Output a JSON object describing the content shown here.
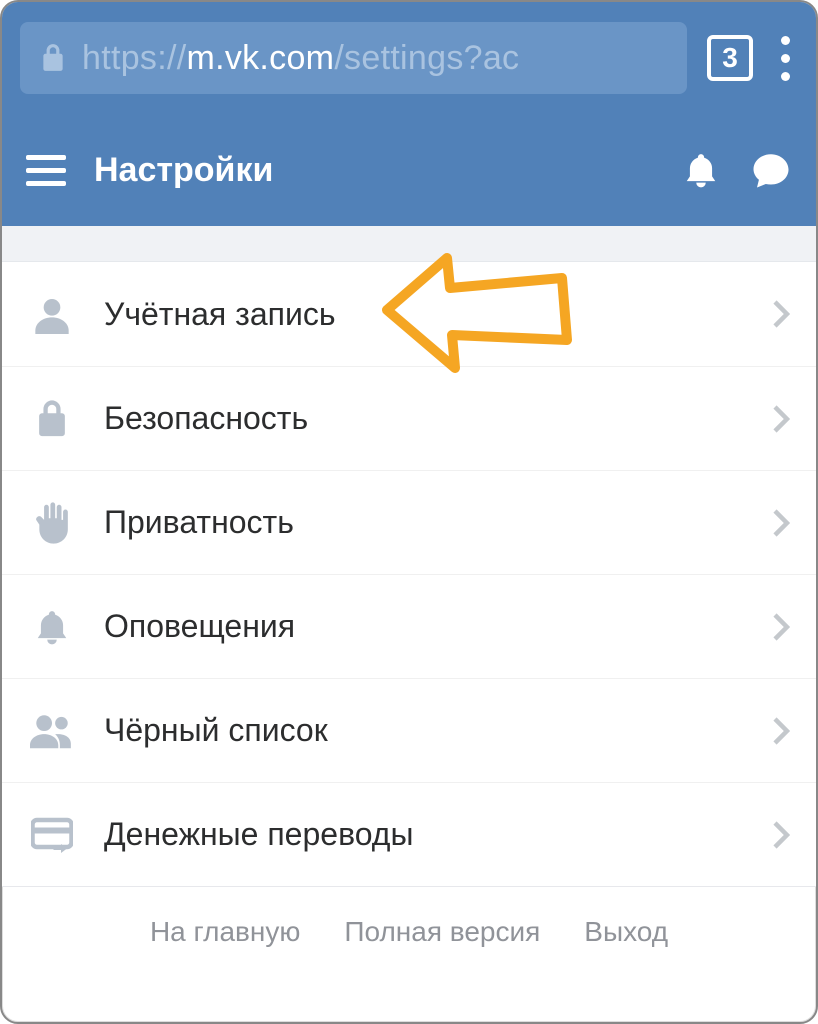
{
  "browser": {
    "url_prefix": "https://",
    "url_host": "m.vk.com",
    "url_path": "/settings?ac",
    "tab_count": "3"
  },
  "header": {
    "title": "Настройки"
  },
  "menu": {
    "items": [
      {
        "icon": "person",
        "label": "Учётная запись"
      },
      {
        "icon": "lock",
        "label": "Безопасность"
      },
      {
        "icon": "hand",
        "label": "Приватность"
      },
      {
        "icon": "bell",
        "label": "Оповещения"
      },
      {
        "icon": "people",
        "label": "Чёрный список"
      },
      {
        "icon": "card",
        "label": "Денежные переводы"
      }
    ]
  },
  "footer": {
    "home": "На главную",
    "full": "Полная версия",
    "logout": "Выход"
  }
}
